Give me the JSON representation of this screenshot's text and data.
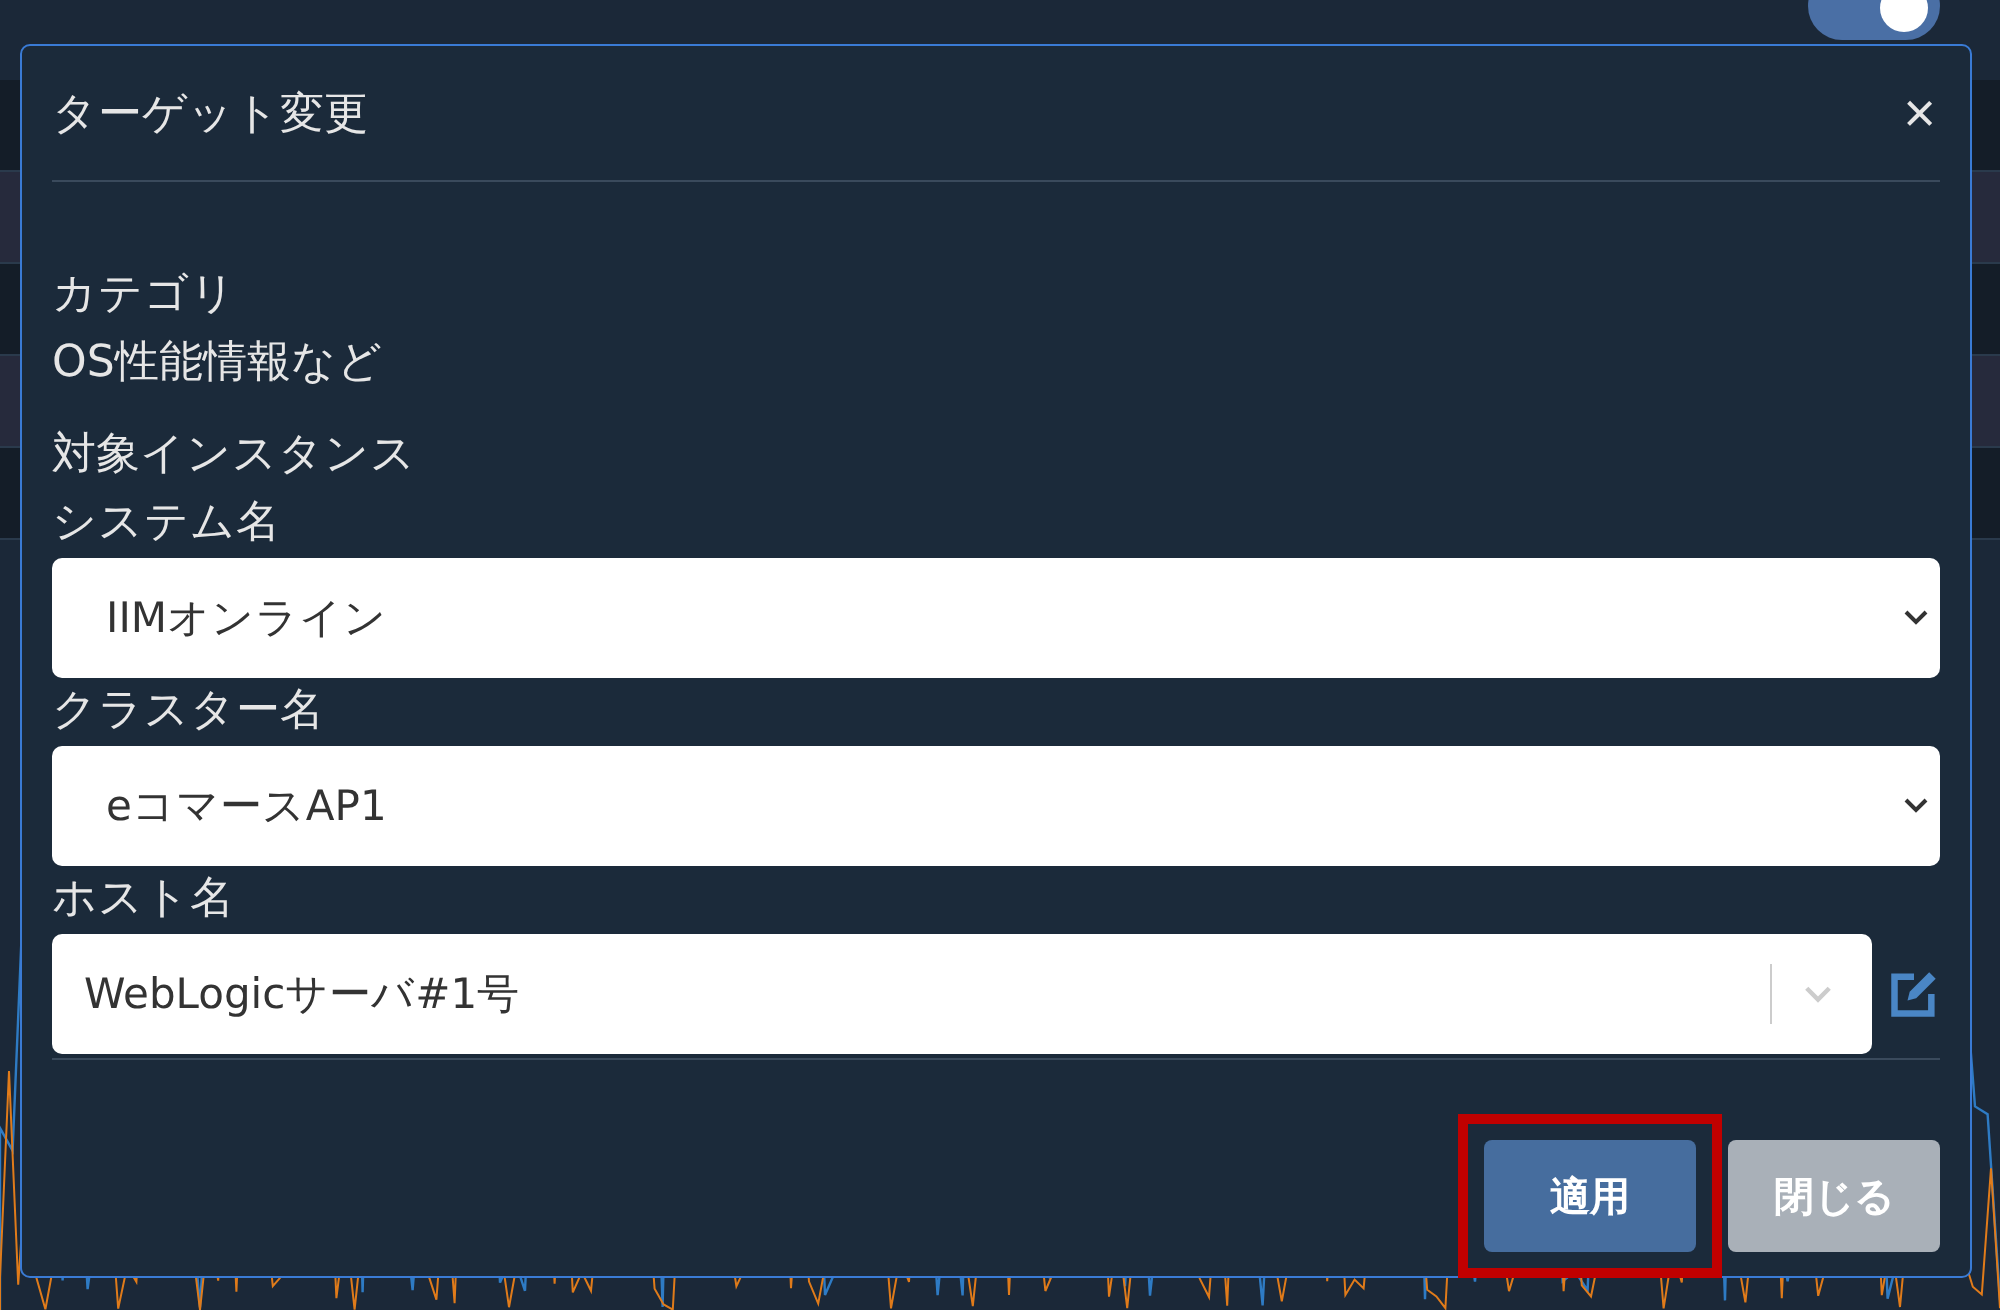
{
  "background": {
    "toggle": {
      "on": true
    }
  },
  "dialog": {
    "title": "ターゲット変更",
    "close": "×",
    "category": {
      "label": "カテゴリ",
      "value": "OS性能情報など"
    },
    "section": "対象インスタンス",
    "fields": [
      {
        "kind": "select",
        "label": "システム名",
        "value": "IIMオンライン"
      },
      {
        "kind": "select",
        "label": "クラスター名",
        "value": "eコマースAP1"
      },
      {
        "kind": "combo",
        "label": "ホスト名",
        "value": "WebLogicサーバ#1号"
      }
    ],
    "buttons": [
      {
        "kind": "primary",
        "label": "適用",
        "highlighted": true
      },
      {
        "kind": "secondary",
        "label": "閉じる",
        "highlighted": false
      }
    ]
  }
}
